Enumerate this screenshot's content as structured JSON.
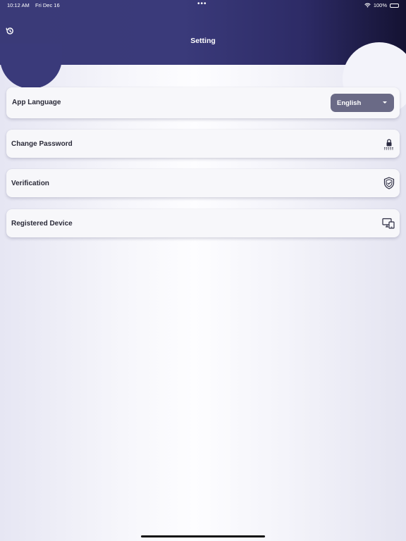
{
  "status_bar": {
    "time": "10:12 AM",
    "date": "Fri Dec 16",
    "dots": "•••",
    "battery_text": "100%"
  },
  "header": {
    "title": "Setting",
    "back_icon": "history-back-icon",
    "background_color": "#3a3a7a"
  },
  "settings": {
    "language": {
      "label": "App Language",
      "selected": "English",
      "caret_icon": "caret-down-icon"
    },
    "change_password": {
      "label": "Change Password",
      "icon": "lock-password-icon"
    },
    "verification": {
      "label": "Verification",
      "icon": "shield-check-icon"
    },
    "registered_device": {
      "label": "Registered Device",
      "icon": "devices-icon"
    }
  },
  "colors": {
    "header_start": "#3a3a78",
    "header_end": "#141232",
    "dropdown_bg": "#6a6a86",
    "card_bg": "#f7f7fa"
  }
}
